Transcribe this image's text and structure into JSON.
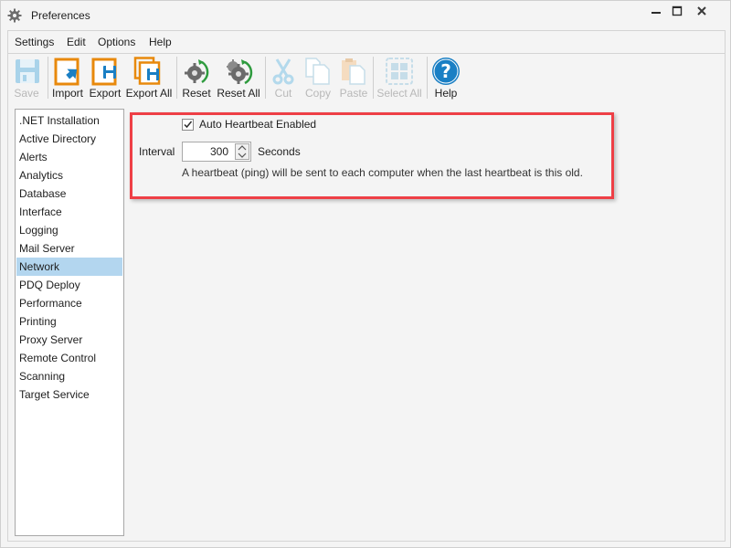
{
  "window": {
    "title": "Preferences",
    "controls": {
      "minimize": "minimize-icon",
      "maximize": "maximize-icon",
      "close": "close-icon"
    }
  },
  "menu": {
    "items": [
      {
        "label": "Settings"
      },
      {
        "label": "Edit"
      },
      {
        "label": "Options"
      },
      {
        "label": "Help"
      }
    ]
  },
  "toolbar": {
    "buttons": [
      {
        "label": "Save",
        "icon": "floppy-disk-icon",
        "enabled": false
      },
      {
        "label": "Import",
        "icon": "import-icon",
        "enabled": true
      },
      {
        "label": "Export",
        "icon": "export-icon",
        "enabled": true
      },
      {
        "label": "Export All",
        "icon": "export-all-icon",
        "enabled": true
      },
      {
        "label": "Reset",
        "icon": "reset-gear-icon",
        "enabled": true
      },
      {
        "label": "Reset All",
        "icon": "reset-all-gears-icon",
        "enabled": true
      },
      {
        "label": "Cut",
        "icon": "scissors-icon",
        "enabled": false
      },
      {
        "label": "Copy",
        "icon": "copy-icon",
        "enabled": false
      },
      {
        "label": "Paste",
        "icon": "paste-icon",
        "enabled": false
      },
      {
        "label": "Select All",
        "icon": "select-all-icon",
        "enabled": false
      },
      {
        "label": "Help",
        "icon": "help-icon",
        "enabled": true
      }
    ]
  },
  "nav": {
    "selected": "Network",
    "items": [
      {
        "label": ".NET Installation"
      },
      {
        "label": "Active Directory"
      },
      {
        "label": "Alerts"
      },
      {
        "label": "Analytics"
      },
      {
        "label": "Database"
      },
      {
        "label": "Interface"
      },
      {
        "label": "Logging"
      },
      {
        "label": "Mail Server"
      },
      {
        "label": "Network"
      },
      {
        "label": "PDQ Deploy"
      },
      {
        "label": "Performance"
      },
      {
        "label": "Printing"
      },
      {
        "label": "Proxy Server"
      },
      {
        "label": "Remote Control"
      },
      {
        "label": "Scanning"
      },
      {
        "label": "Target Service"
      }
    ]
  },
  "network": {
    "auto_heartbeat_label": "Auto Heartbeat Enabled",
    "auto_heartbeat_checked": true,
    "interval_label": "Interval",
    "interval_value": "300",
    "interval_unit": "Seconds",
    "description": "A heartbeat (ping) will be sent to each computer when the last heartbeat is this old."
  },
  "colors": {
    "highlight_border": "#ee3f46",
    "selection": "#b3d6ef",
    "accent_orange": "#e8890c",
    "accent_blue": "#1a7fc4",
    "reset_green": "#2e9b3e"
  }
}
